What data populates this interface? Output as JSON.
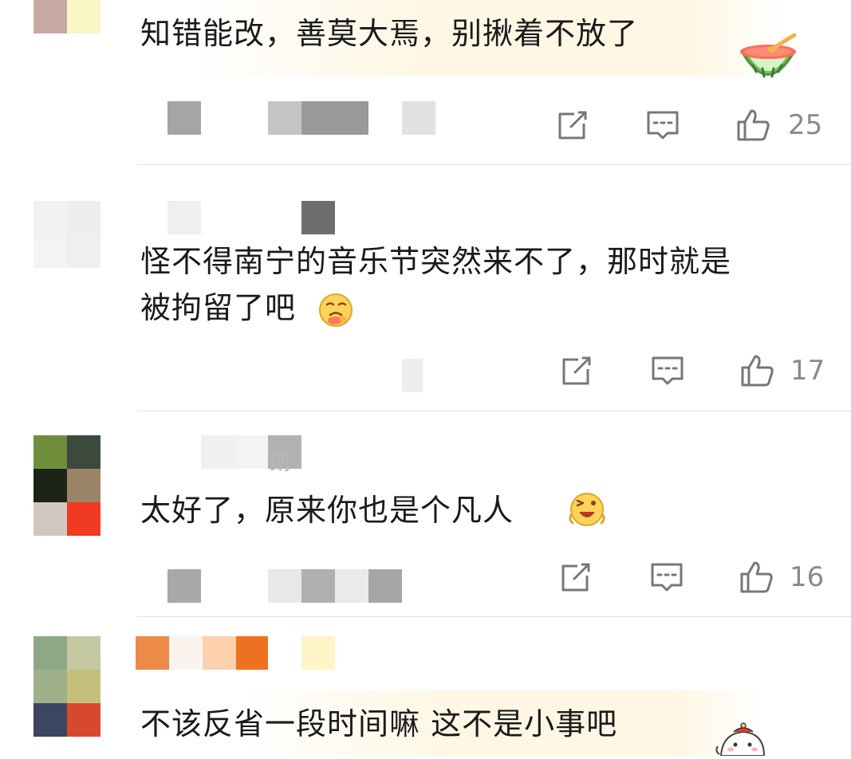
{
  "colors": {
    "text": "#1a1a1a",
    "muted": "#8a8a8a",
    "icon": "#777777",
    "divider": "#e3e3e3"
  },
  "comments": [
    {
      "text": "知错能改，善莫大焉，别揪着不放了",
      "emoji": "watermelon-bowl-sticker",
      "actions": {
        "repost_icon": "repost-icon",
        "reply_icon": "reply-icon",
        "like_icon": "thumbs-up-icon",
        "likes": "25"
      }
    },
    {
      "text": "怪不得南宁的音乐节突然来不了，那时就是",
      "text_line2": "被拘留了吧",
      "emoji": "thinking-face-emoji",
      "actions": {
        "repost_icon": "repost-icon",
        "reply_icon": "reply-icon",
        "like_icon": "thumbs-up-icon",
        "likes": "17"
      }
    },
    {
      "name_fragment": "朗",
      "text": "太好了，原来你也是个凡人",
      "emoji": "winking-laughing-emoji",
      "actions": {
        "repost_icon": "repost-icon",
        "reply_icon": "reply-icon",
        "like_icon": "thumbs-up-icon",
        "likes": "16"
      }
    },
    {
      "text": "不该反省一段时间嘛 这不是小事吧",
      "emoji": "cartoon-character-sticker"
    }
  ]
}
